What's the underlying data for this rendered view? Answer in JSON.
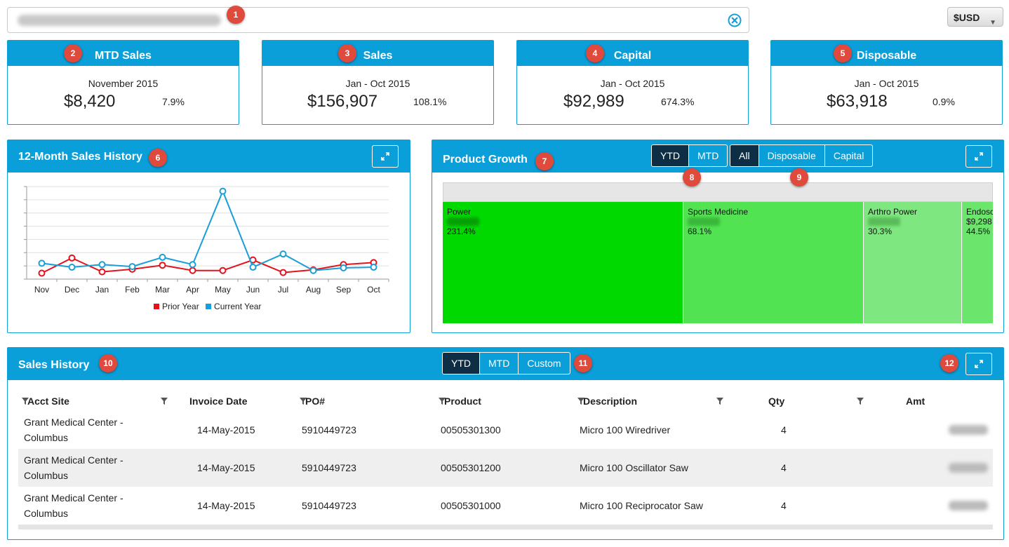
{
  "header": {
    "account_blurred": "",
    "currency": "$USD"
  },
  "badges": [
    "1",
    "2",
    "3",
    "4",
    "5",
    "6",
    "7",
    "8",
    "9",
    "10",
    "11",
    "12"
  ],
  "kpis": [
    {
      "title": "MTD Sales",
      "period": "November 2015",
      "value": "$8,420",
      "pct": "7.9%"
    },
    {
      "title": "Sales",
      "period": "Jan - Oct 2015",
      "value": "$156,907",
      "pct": "108.1%"
    },
    {
      "title": "Capital",
      "period": "Jan - Oct 2015",
      "value": "$92,989",
      "pct": "674.3%"
    },
    {
      "title": "Disposable",
      "period": "Jan - Oct 2015",
      "value": "$63,918",
      "pct": "0.9%"
    }
  ],
  "sales_history_12m": {
    "title": "12-Month Sales History",
    "legend": {
      "prior": "Prior Year",
      "current": "Current Year"
    }
  },
  "chart_data": {
    "type": "line",
    "categories": [
      "Nov",
      "Dec",
      "Jan",
      "Feb",
      "Mar",
      "Apr",
      "May",
      "Jun",
      "Jul",
      "Aug",
      "Sep",
      "Oct"
    ],
    "series": [
      {
        "name": "Prior Year",
        "color": "#e3121b",
        "values": [
          0.9,
          3.2,
          1.1,
          1.5,
          2.1,
          1.3,
          1.3,
          2.9,
          1.0,
          1.4,
          2.2,
          2.5
        ]
      },
      {
        "name": "Current Year",
        "color": "#1a9ed8",
        "values": [
          2.4,
          1.8,
          2.2,
          1.9,
          3.3,
          2.2,
          13.3,
          1.8,
          3.8,
          1.3,
          1.7,
          1.8
        ]
      }
    ],
    "ylim": [
      0,
      14
    ],
    "grid": true,
    "legend_position": "bottom"
  },
  "product_growth": {
    "title": "Product Growth",
    "period_tabs": [
      {
        "label": "YTD",
        "active": true
      },
      {
        "label": "MTD",
        "active": false
      }
    ],
    "filter_tabs": [
      {
        "label": "All",
        "active": true
      },
      {
        "label": "Disposable",
        "active": false
      },
      {
        "label": "Capital",
        "active": false
      }
    ],
    "cells": [
      {
        "label": "Power",
        "amount": "",
        "pct": "231.4%",
        "color": "#00d900"
      },
      {
        "label": "Sports Medicine",
        "amount": "",
        "pct": "68.1%",
        "color": "#52e352"
      },
      {
        "label": "Arthro Power",
        "amount": "",
        "pct": "30.3%",
        "color": "#7fe77f"
      },
      {
        "label": "Endosc",
        "amount": "$9,298",
        "pct": "44.5%",
        "color": "#6be56b"
      }
    ]
  },
  "sales_history": {
    "title": "Sales History",
    "tabs": [
      {
        "label": "YTD",
        "active": true
      },
      {
        "label": "MTD",
        "active": false
      },
      {
        "label": "Custom",
        "active": false
      }
    ],
    "columns": [
      "Acct Site",
      "Invoice Date",
      "PO#",
      "Product",
      "Description",
      "Qty",
      "Amt"
    ],
    "rows": [
      {
        "site1": "Grant Medical Center -",
        "site2": "Columbus",
        "date": "14-May-2015",
        "po": "5910449723",
        "product": "00505301300",
        "desc": "Micro 100 Wiredriver",
        "qty": "4"
      },
      {
        "site1": "Grant Medical Center -",
        "site2": "Columbus",
        "date": "14-May-2015",
        "po": "5910449723",
        "product": "00505301200",
        "desc": "Micro 100 Oscillator Saw",
        "qty": "4"
      },
      {
        "site1": "Grant Medical Center -",
        "site2": "Columbus",
        "date": "14-May-2015",
        "po": "5910449723",
        "product": "00505301000",
        "desc": "Micro 100 Reciprocator Saw",
        "qty": "4"
      }
    ]
  }
}
